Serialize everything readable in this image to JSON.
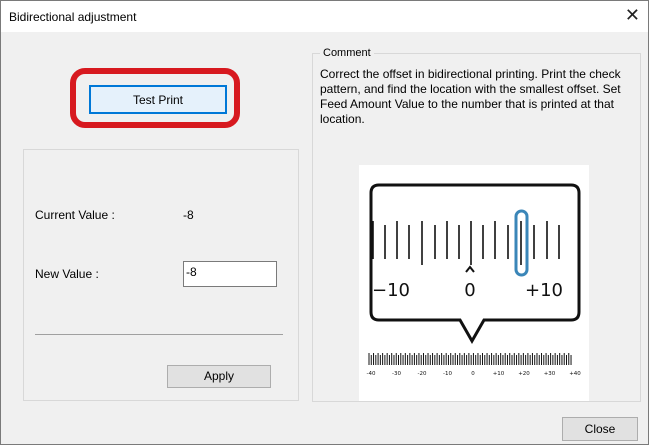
{
  "window": {
    "title": "Bidirectional adjustment",
    "close_glyph": "✕"
  },
  "buttons": {
    "test_print": "Test Print",
    "apply": "Apply",
    "close": "Close"
  },
  "fields": {
    "current_value_label": "Current Value :",
    "current_value": "-8",
    "new_value_label": "New Value :",
    "new_value": "-8"
  },
  "comment": {
    "legend": "Comment",
    "text": "Correct the offset in bidirectional printing. Print the check pattern, and find the location with the smallest offset. Set Feed Amount Value to the number that is printed at that location."
  },
  "diagram": {
    "zoom_labels": [
      "−10",
      "0",
      "+10"
    ],
    "scale_labels": [
      "-40",
      "-30",
      "-20",
      "-10",
      "0",
      "+10",
      "+20",
      "+30",
      "+40"
    ],
    "highlight_color": "#3a86b8",
    "accent_color": "#d7191f"
  }
}
